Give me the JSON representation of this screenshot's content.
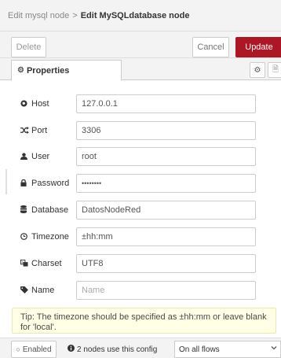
{
  "breadcrumb": {
    "parent": "Edit mysql node",
    "separator": ">",
    "current": "Edit MySQLdatabase node"
  },
  "toolbar": {
    "delete_label": "Delete",
    "cancel_label": "Cancel",
    "update_label": "Update"
  },
  "tabs": {
    "properties_label": "Properties",
    "gear_icon": "⚙",
    "doc_icon": "🗎"
  },
  "fields": {
    "host": {
      "label": "Host",
      "icon": "globe-icon",
      "value": "127.0.0.1"
    },
    "port": {
      "label": "Port",
      "icon": "random-icon",
      "value": "3306"
    },
    "user": {
      "label": "User",
      "icon": "user-icon",
      "value": "root"
    },
    "password": {
      "label": "Password",
      "icon": "lock-icon",
      "value": "••••••••"
    },
    "database": {
      "label": "Database",
      "icon": "database-icon",
      "value": "DatosNodeRed"
    },
    "timezone": {
      "label": "Timezone",
      "icon": "clock-icon",
      "value": "±hh:mm"
    },
    "charset": {
      "label": "Charset",
      "icon": "language-icon",
      "value": "UTF8"
    },
    "name": {
      "label": "Name",
      "icon": "tag-icon",
      "value": "",
      "placeholder": "Name"
    }
  },
  "tip": "Tip: The timezone should be specified as ±hh:mm or leave blank for 'local'.",
  "footer": {
    "enabled_label": "Enabled",
    "usage_text": "2 nodes use this config",
    "flows_select": "On all flows"
  },
  "colors": {
    "update_bg": "#ad1625",
    "tip_bg": "#ffffe6",
    "header_bg": "#f3f3f3"
  }
}
